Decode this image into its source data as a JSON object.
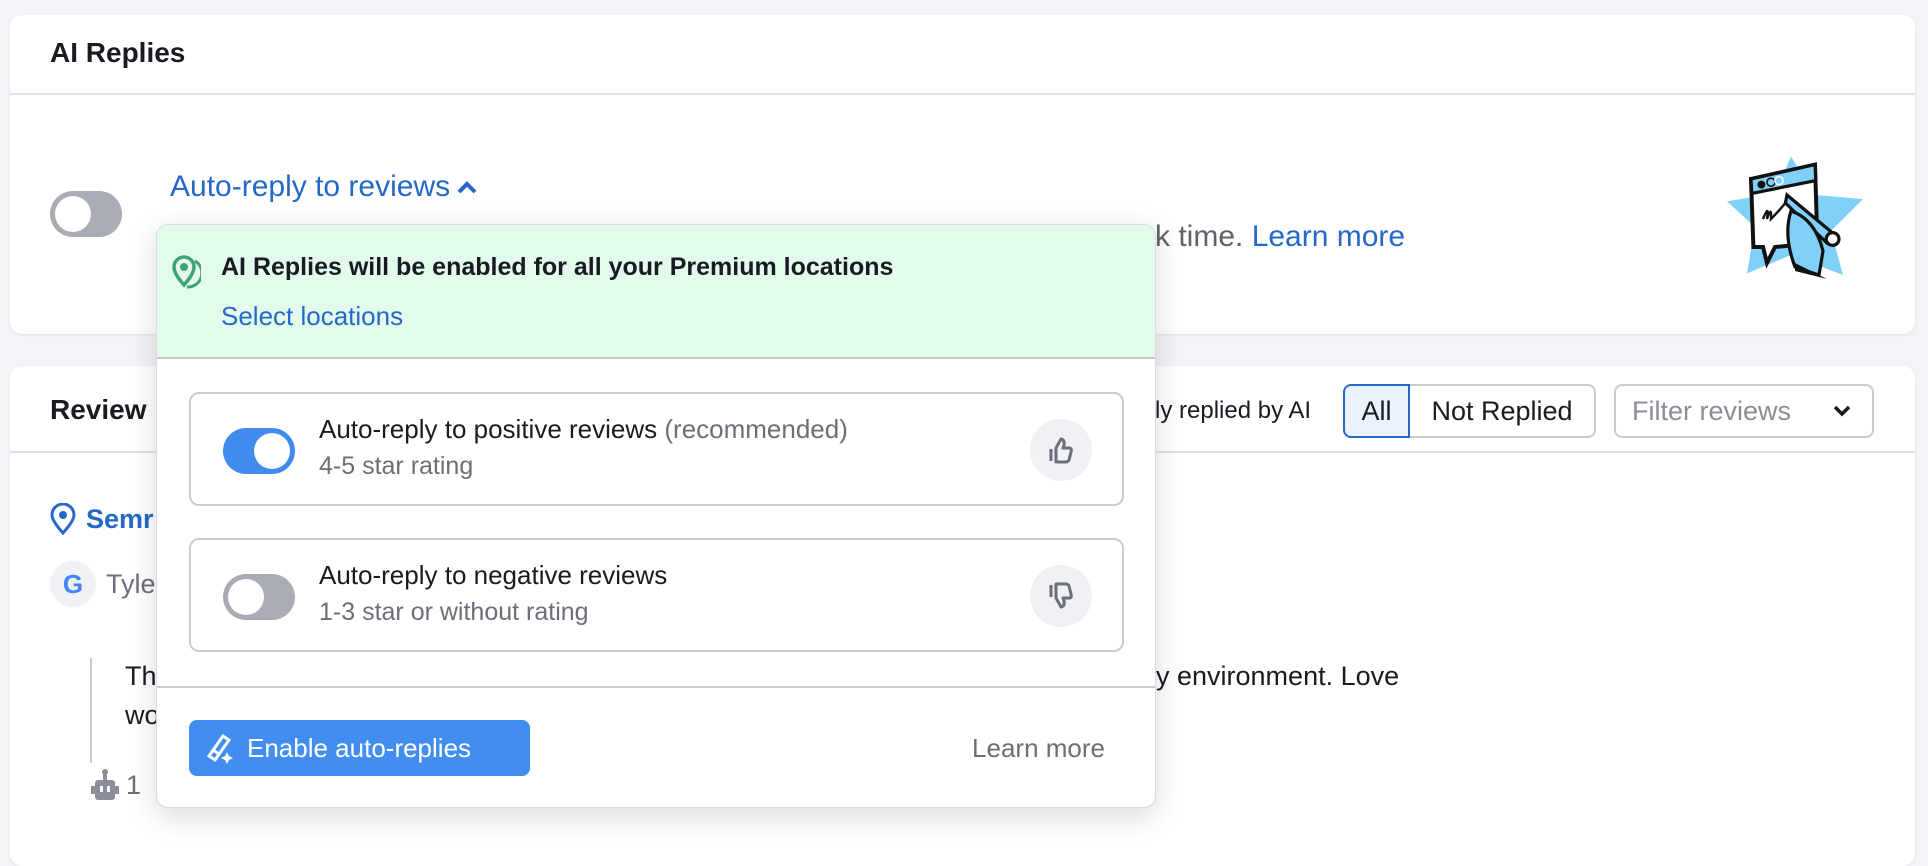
{
  "ai_card": {
    "title": "AI Replies",
    "auto_reply_link": "Auto-reply to reviews",
    "auto_reply_enabled": false,
    "description_visible": "rk time.",
    "learn_more": "Learn more"
  },
  "reviews_card": {
    "title": "Review",
    "filter_label_visible": "ly replied by AI",
    "segments": [
      {
        "label": "All",
        "selected": true
      },
      {
        "label": "Not Replied",
        "selected": false
      }
    ],
    "filter_placeholder": "Filter reviews",
    "location_visible": "Semr",
    "author_visible": "Tyle",
    "review_line1_left": "Th",
    "review_line1_right": "y environment. Love",
    "review_line2_left": "wo",
    "bot_count": "1"
  },
  "popup": {
    "banner_text": "AI Replies will be enabled for all your Premium locations",
    "select_locations": "Select locations",
    "options": [
      {
        "title": "Auto-reply to positive reviews",
        "note": "(recommended)",
        "subtitle": "4-5 star rating",
        "enabled": true,
        "icon": "thumbs-up-icon"
      },
      {
        "title": "Auto-reply to negative reviews",
        "note": "",
        "subtitle": "1-3 star or without rating",
        "enabled": false,
        "icon": "thumbs-down-icon"
      }
    ],
    "enable_button": "Enable auto-replies",
    "learn_more": "Learn more"
  },
  "colors": {
    "accent": "#3f8cee",
    "link": "#2468c9",
    "banner": "#e2fbeb",
    "location_icon": "#3fa37a"
  }
}
